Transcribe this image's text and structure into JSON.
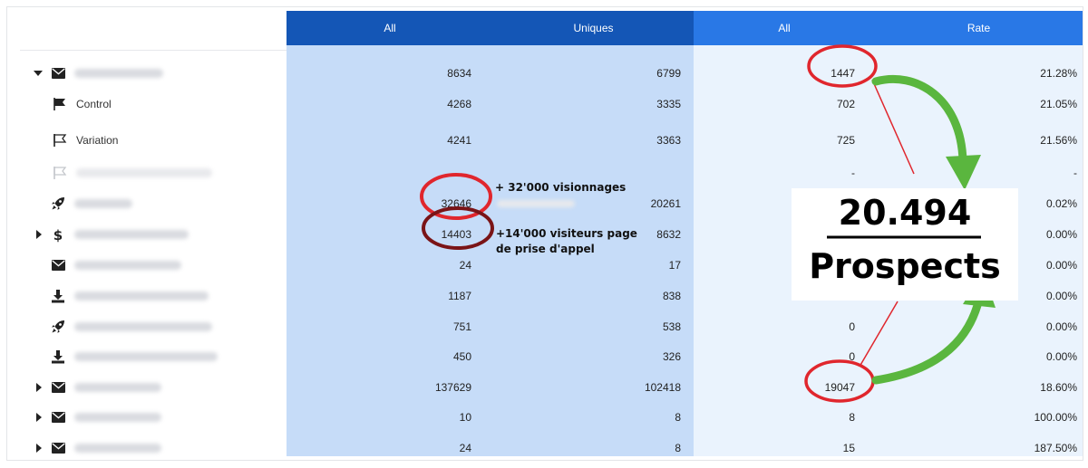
{
  "columns": [
    {
      "label": "All"
    },
    {
      "label": "Uniques"
    },
    {
      "label": "All"
    },
    {
      "label": "Rate"
    }
  ],
  "rows": [
    {
      "label": "",
      "icon": "envelope-icon",
      "expander": "caret-down-icon",
      "blur": 98,
      "all": "8634",
      "uniques": "6799",
      "all2": "1447",
      "rate": "21.28%"
    },
    {
      "label": "Control",
      "icon": "flag-filled-icon",
      "sub": true,
      "all": "4268",
      "uniques": "3335",
      "all2": "702",
      "rate": "21.05%"
    },
    {
      "label": "Variation",
      "icon": "flag-outline-icon",
      "sub": true,
      "all": "4241",
      "uniques": "3363",
      "all2": "725",
      "rate": "21.56%"
    },
    {
      "label": "",
      "icon": "flag-outline-icon",
      "sub": true,
      "faint": true,
      "blur": 150,
      "all": "",
      "uniques": "",
      "all2": "-",
      "rate": "-"
    },
    {
      "label": "",
      "icon": "rocket-icon",
      "blur": 64,
      "all": "32646",
      "uniques": "20261",
      "all2": "",
      "rate": "0.02%"
    },
    {
      "label": "",
      "icon": "dollar-icon",
      "expander": "caret-right-icon",
      "blur": 126,
      "all": "14403",
      "uniques": "8632",
      "all2": "",
      "rate": "0.00%"
    },
    {
      "label": "",
      "icon": "envelope-icon",
      "blur": 118,
      "all": "24",
      "uniques": "17",
      "all2": "",
      "rate": "0.00%"
    },
    {
      "label": "",
      "icon": "download-icon",
      "blur": 148,
      "all": "1187",
      "uniques": "838",
      "all2": "",
      "rate": "0.00%"
    },
    {
      "label": "",
      "icon": "rocket-icon",
      "blur": 152,
      "all": "751",
      "uniques": "538",
      "all2": "0",
      "rate": "0.00%"
    },
    {
      "label": "",
      "icon": "download-icon",
      "blur": 158,
      "all": "450",
      "uniques": "326",
      "all2": "0",
      "rate": "0.00%"
    },
    {
      "label": "",
      "icon": "envelope-icon",
      "expander": "caret-right-icon",
      "blur": 96,
      "all": "137629",
      "uniques": "102418",
      "all2": "19047",
      "rate": "18.60%"
    },
    {
      "label": "",
      "icon": "envelope-icon",
      "expander": "caret-right-icon",
      "blur": 96,
      "all": "10",
      "uniques": "8",
      "all2": "8",
      "rate": "100.00%"
    },
    {
      "label": "",
      "icon": "envelope-icon",
      "expander": "caret-right-icon",
      "blur": 96,
      "all": "24",
      "uniques": "8",
      "all2": "15",
      "rate": "187.50%"
    }
  ],
  "annotations": {
    "views": "+ 32'000 visionnages",
    "visitors_line1": "+14'000 visiteurs page",
    "visitors_line2": "de prise d'appel",
    "big_number": "20.494",
    "big_label": "Prospects"
  },
  "colors": {
    "header_dark": "#1456b6",
    "header_light": "#2978e6",
    "band_dark": "#c6dcf8",
    "band_light": "#eaf3fd",
    "circle_red": "#e0262d",
    "circle_dark": "#7a1417",
    "arrow_green": "#5ab63e"
  }
}
